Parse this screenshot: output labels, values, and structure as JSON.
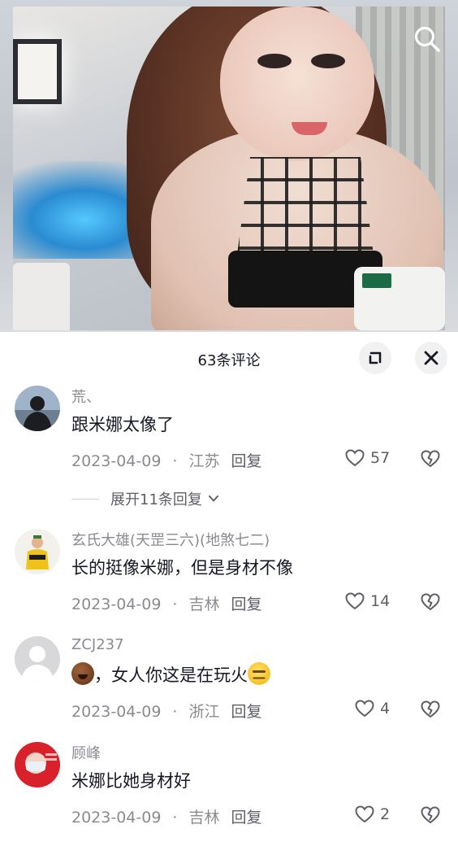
{
  "video": {
    "search_icon": "search-icon"
  },
  "panel": {
    "title": "63条评论",
    "expand_icon": "expand-icon",
    "close_icon": "close-icon"
  },
  "comments": [
    {
      "user": "荒、",
      "text": "跟米娜太像了",
      "date": "2023-04-09",
      "location": "江苏",
      "reply_label": "回复",
      "likes": "57",
      "avatar_colors": [
        "#9fb3c9",
        "#1c1d20"
      ]
    },
    {
      "user": "玄氏大雄(天罡三六)(地煞七二)",
      "text": "长的挺像米娜，但是身材不像",
      "date": "2023-04-09",
      "location": "吉林",
      "reply_label": "回复",
      "likes": "14",
      "avatar_colors": [
        "#f3f1ec",
        "#f0c21a"
      ]
    },
    {
      "user": "ZCJ237",
      "text_before": "，女人你这是在玩火",
      "date": "2023-04-09",
      "location": "浙江",
      "reply_label": "回复",
      "likes": "4",
      "avatar_colors": [
        "#d8d8da",
        "#ffffff"
      ]
    },
    {
      "user": "顾峰",
      "text": "米娜比她身材好",
      "date": "2023-04-09",
      "location": "吉林",
      "reply_label": "回复",
      "likes": "2",
      "avatar_colors": [
        "#d8212a",
        "#e9f0f7"
      ]
    }
  ],
  "expand_replies": {
    "label": "展开11条回复"
  },
  "colors": {
    "text_primary": "#161823",
    "text_secondary": "#8a8b91",
    "button_bg": "#f1f1f2"
  }
}
